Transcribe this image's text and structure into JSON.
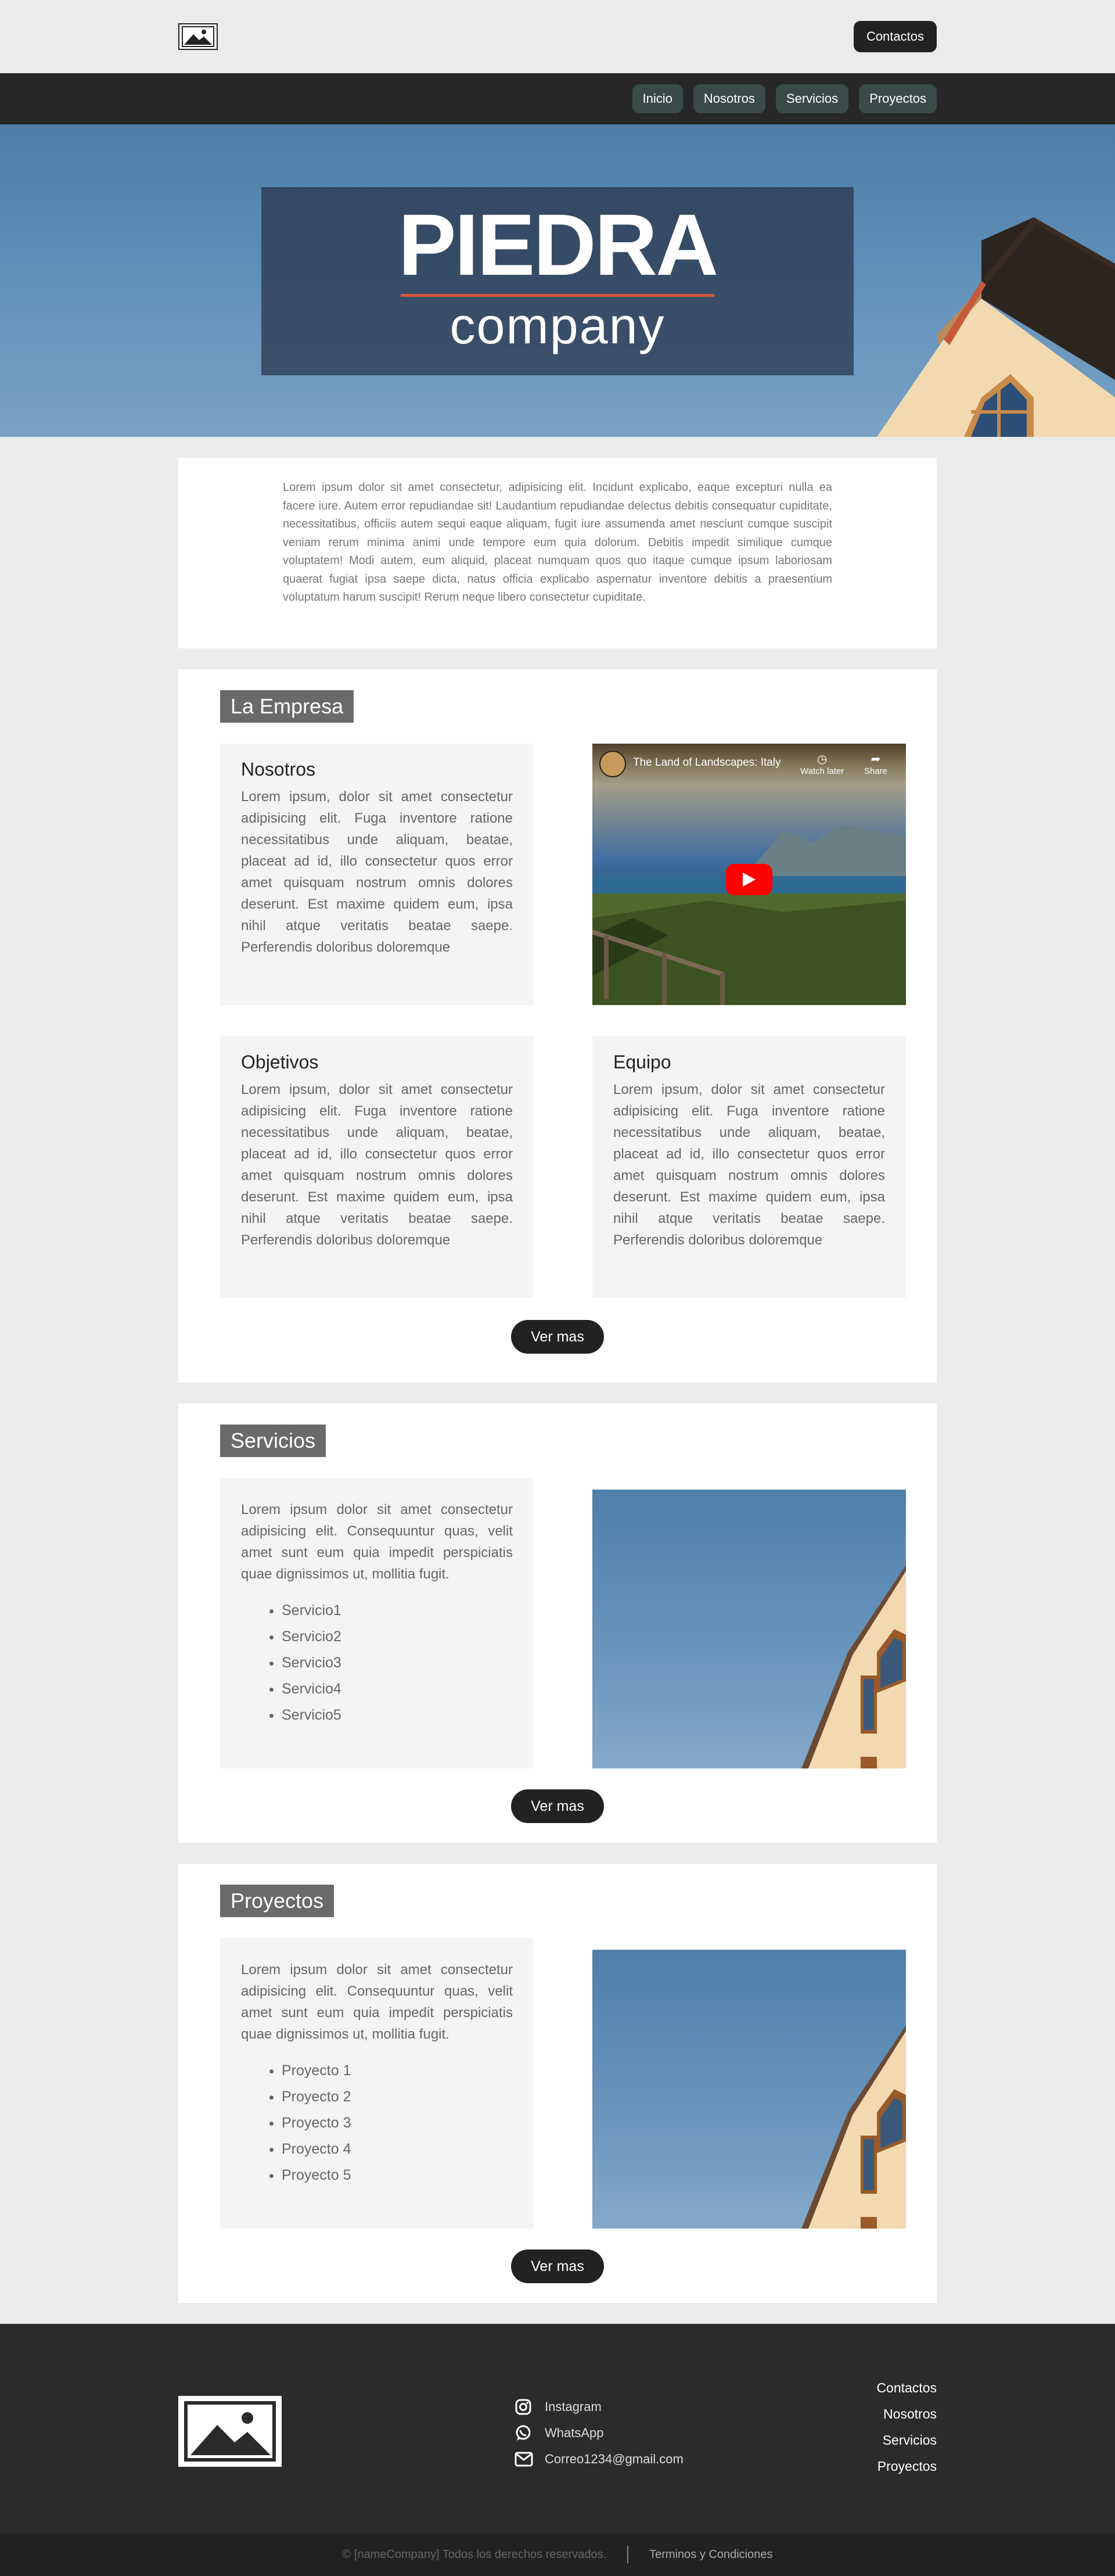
{
  "header": {
    "contact_button": "Contactos"
  },
  "nav": {
    "items": [
      "Inicio",
      "Nosotros",
      "Servicios",
      "Proyectos"
    ]
  },
  "hero": {
    "title": "PIEDRA",
    "subtitle": "company"
  },
  "intro": {
    "text": "Lorem ipsum dolor sit amet consectetur, adipisicing elit. Incidunt explicabo, eaque excepturi nulla ea facere iure. Autem error repudiandae sit! Laudantium repudiandae delectus debitis consequatur cupiditate, necessitatibus, officiis autem sequi eaque aliquam, fugit iure assumenda amet nesciunt cumque suscipit veniam rerum minima animi unde tempore eum quia dolorum. Debitis impedit similique cumque voluptatem! Modi autem, eum aliquid, placeat numquam quos quo itaque cumque ipsum laboriosam quaerat fugiat ipsa saepe dicta, natus officia explicabo aspernatur inventore debitis a praesentium voluptatum harum suscipit! Rerum neque libero consectetur cupiditate."
  },
  "empresa": {
    "tag": "La Empresa",
    "nosotros": {
      "title": "Nosotros",
      "text": "Lorem ipsum, dolor sit amet consectetur adipisicing elit. Fuga inventore ratione necessitatibus unde aliquam, beatae, placeat ad id, illo consectetur quos error amet quisquam nostrum omnis dolores deserunt. Est maxime quidem eum, ipsa nihil atque veritatis beatae saepe. Perferendis doloribus doloremque"
    },
    "objetivos": {
      "title": "Objetivos",
      "text": "Lorem ipsum, dolor sit amet consectetur adipisicing elit. Fuga inventore ratione necessitatibus unde aliquam, beatae, placeat ad id, illo consectetur quos error amet quisquam nostrum omnis dolores deserunt. Est maxime quidem eum, ipsa nihil atque veritatis beatae saepe. Perferendis doloribus doloremque"
    },
    "equipo": {
      "title": "Equipo",
      "text": "Lorem ipsum, dolor sit amet consectetur adipisicing elit. Fuga inventore ratione necessitatibus unde aliquam, beatae, placeat ad id, illo consectetur quos error amet quisquam nostrum omnis dolores deserunt. Est maxime quidem eum, ipsa nihil atque veritatis beatae saepe. Perferendis doloribus doloremque"
    },
    "video": {
      "title": "The Land of Landscapes: Italy",
      "watch_later": "Watch later",
      "share": "Share"
    },
    "more_button": "Ver mas"
  },
  "servicios": {
    "tag": "Servicios",
    "text": "Lorem ipsum dolor sit amet consectetur adipisicing elit. Consequuntur quas, velit amet sunt eum quia impedit perspiciatis quae dignissimos ut, mollitia fugit.",
    "items": [
      "Servicio1",
      "Servicio2",
      "Servicio3",
      "Servicio4",
      "Servicio5"
    ],
    "more_button": "Ver mas"
  },
  "proyectos": {
    "tag": "Proyectos",
    "text": "Lorem ipsum dolor sit amet consectetur adipisicing elit. Consequuntur quas, velit amet sunt eum quia impedit perspiciatis quae dignissimos ut, mollitia fugit.",
    "items": [
      "Proyecto 1",
      "Proyecto 2",
      "Proyecto 3",
      "Proyecto 4",
      "Proyecto 5"
    ],
    "more_button": "Ver mas"
  },
  "footer": {
    "contacts": [
      {
        "icon": "instagram-icon",
        "label": "Instagram"
      },
      {
        "icon": "whatsapp-icon",
        "label": "WhatsApp"
      },
      {
        "icon": "mail-icon",
        "label": "Correo1234@gmail.com"
      }
    ],
    "links": [
      "Contactos",
      "Nosotros",
      "Servicios",
      "Proyectos"
    ],
    "copyright": "© [nameCompany] Todos los derechos reservados.",
    "terms": "Terminos y Condiciones"
  },
  "colors": {
    "accent": "#d9573d",
    "dark": "#222222",
    "nav_button": "#3a4a48",
    "panel": "#f4f4f4"
  }
}
